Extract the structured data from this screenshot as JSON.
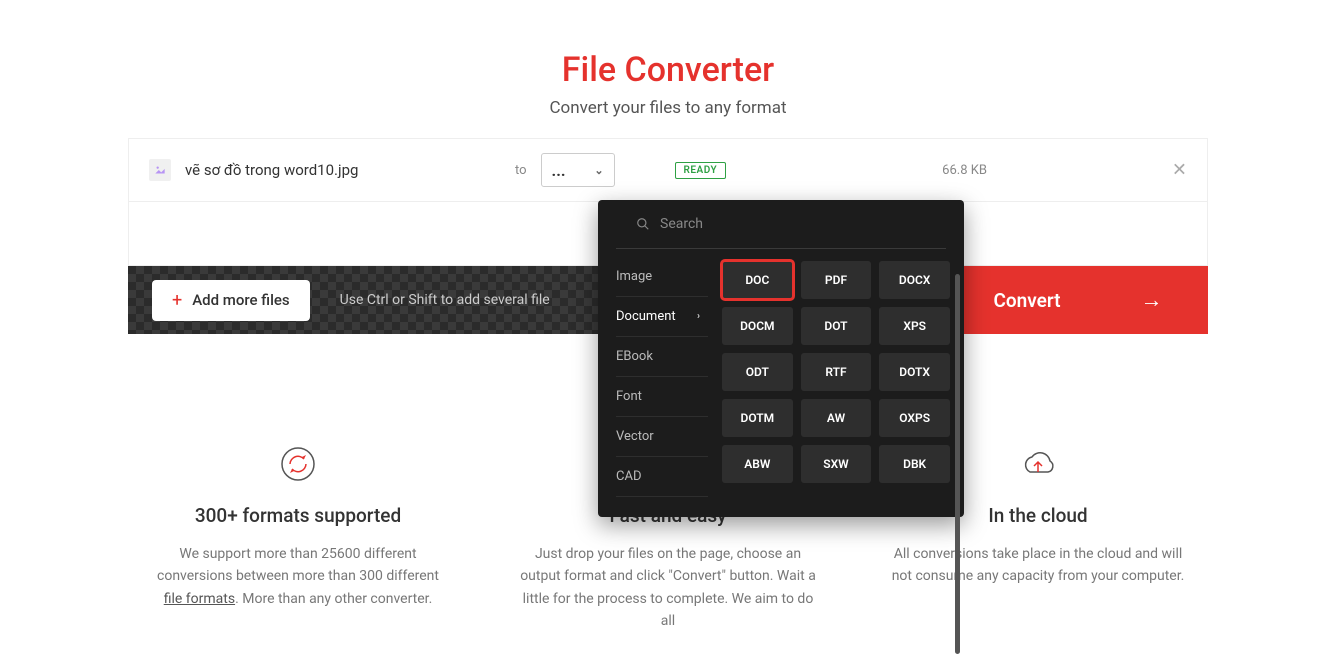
{
  "header": {
    "title": "File Converter",
    "subtitle": "Convert your files to any format"
  },
  "file": {
    "name": "vẽ sơ đồ trong word10.jpg",
    "to_label": "to",
    "selected_format": "...",
    "status": "READY",
    "size": "66.8 KB"
  },
  "actions": {
    "add_more": "Add more files",
    "hint": "Use Ctrl or Shift to add several file",
    "convert": "Convert"
  },
  "dropdown": {
    "search_placeholder": "Search",
    "categories": [
      "Image",
      "Document",
      "EBook",
      "Font",
      "Vector",
      "CAD"
    ],
    "active_category": "Document",
    "formats": [
      "DOC",
      "PDF",
      "DOCX",
      "DOCM",
      "DOT",
      "XPS",
      "ODT",
      "RTF",
      "DOTX",
      "DOTM",
      "AW",
      "OXPS",
      "ABW",
      "SXW",
      "DBK"
    ],
    "highlighted_format": "DOC"
  },
  "features": [
    {
      "title": "300+ formats supported",
      "desc_pre": "We support more than 25600 different conversions between more than 300 different ",
      "link": "file formats",
      "desc_post": ". More than any other converter."
    },
    {
      "title": "Fast and easy",
      "desc": "Just drop your files on the page, choose an output format and click \"Convert\" button. Wait a little for the process to complete. We aim to do all"
    },
    {
      "title": "In the cloud",
      "desc": "All conversions take place in the cloud and will not consume any capacity from your computer."
    }
  ]
}
